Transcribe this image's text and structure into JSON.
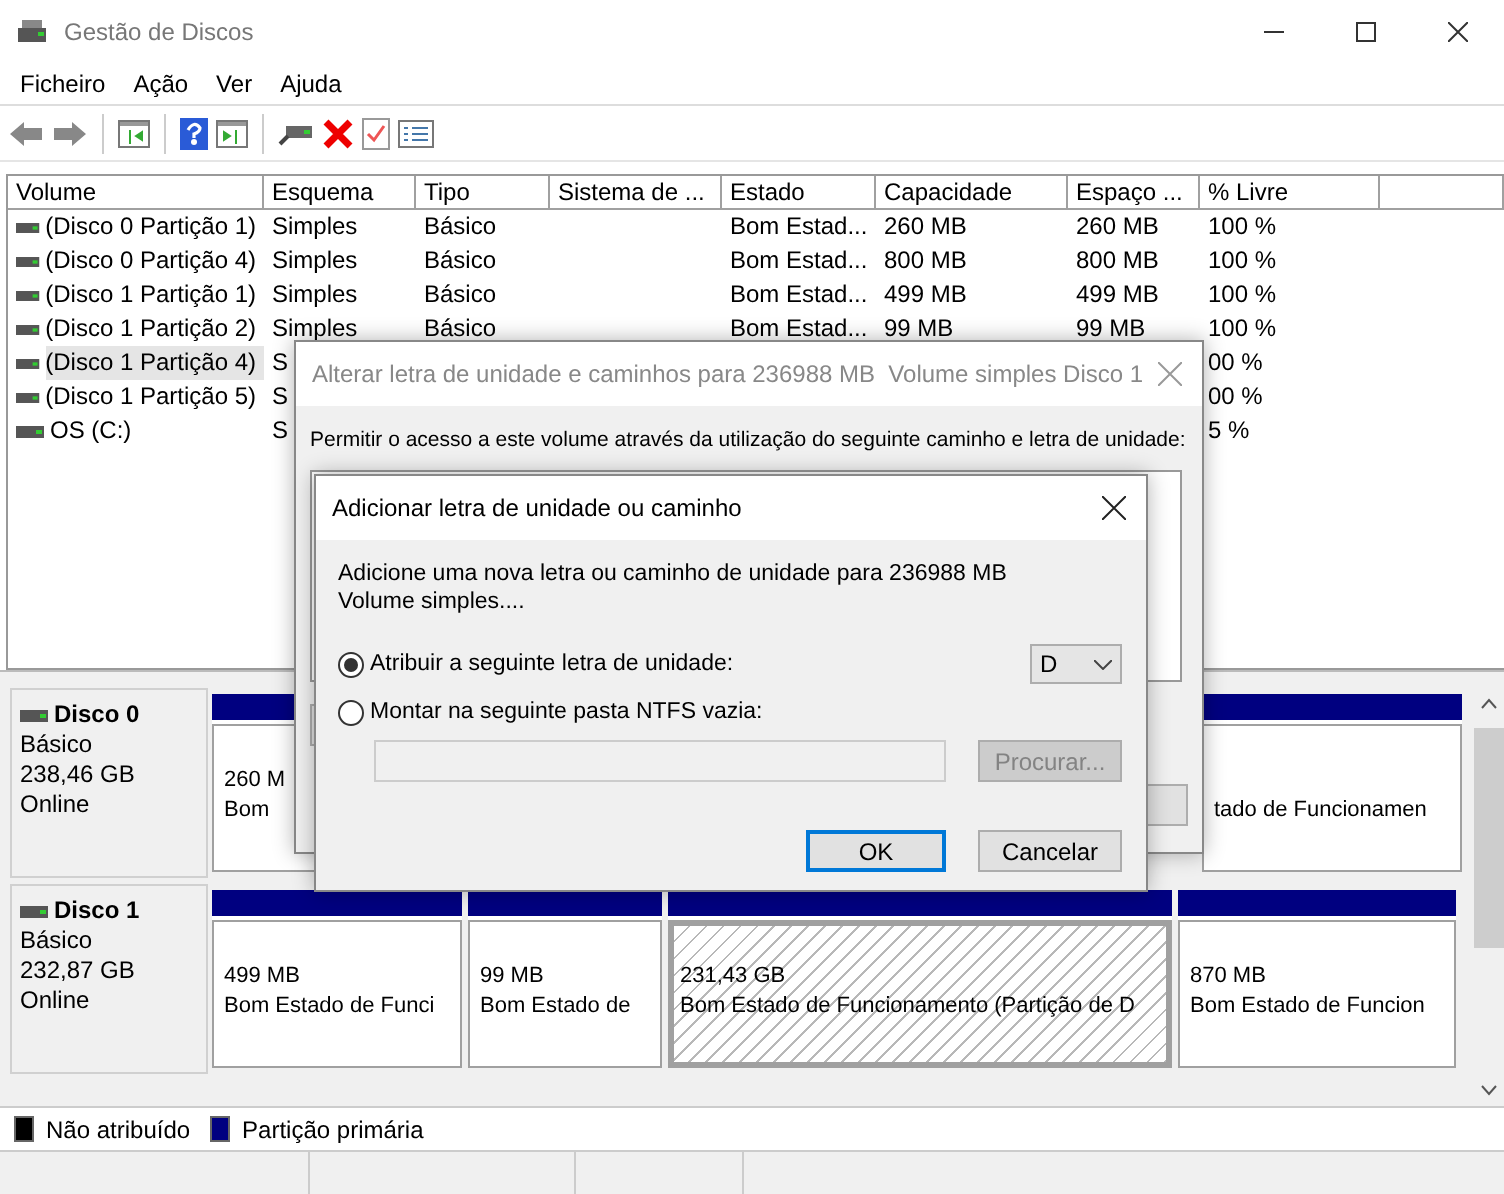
{
  "window": {
    "title": "Gestão de Discos"
  },
  "menu": [
    "Ficheiro",
    "Ação",
    "Ver",
    "Ajuda"
  ],
  "table": {
    "columns": [
      "Volume",
      "Esquema",
      "Tipo",
      "Sistema de ...",
      "Estado",
      "Capacidade",
      "Espaço ...",
      "% Livre"
    ],
    "rows": [
      {
        "selected": false,
        "volume": "(Disco 0 Partição 1)",
        "esquema": "Simples",
        "tipo": "Básico",
        "estado": "Bom Estad...",
        "capacidade": "260 MB",
        "espaco": "260 MB",
        "livre": "100 %"
      },
      {
        "selected": false,
        "volume": "(Disco 0 Partição 4)",
        "esquema": "Simples",
        "tipo": "Básico",
        "estado": "Bom Estad...",
        "capacidade": "800 MB",
        "espaco": "800 MB",
        "livre": "100 %"
      },
      {
        "selected": false,
        "volume": "(Disco 1 Partição 1)",
        "esquema": "Simples",
        "tipo": "Básico",
        "estado": "Bom Estad...",
        "capacidade": "499 MB",
        "espaco": "499 MB",
        "livre": "100 %"
      },
      {
        "selected": false,
        "volume": "(Disco 1 Partição 2)",
        "esquema": "Simples",
        "tipo": "Básico",
        "estado": "Bom Estad...",
        "capacidade": "99 MB",
        "espaco": "99 MB",
        "livre": "100 %"
      },
      {
        "selected": true,
        "volume": "(Disco 1 Partição 4)",
        "esquema": "S",
        "livre": "00 %"
      },
      {
        "selected": false,
        "volume": "(Disco 1 Partição 5)",
        "esquema": "S",
        "livre": "00 %"
      },
      {
        "selected": false,
        "volume": "OS (C:)",
        "esquema": "S",
        "livre": "5 %"
      }
    ]
  },
  "disks": [
    {
      "name": "Disco 0",
      "type": "Básico",
      "size": "238,46 GB",
      "status": "Online",
      "partitions": [
        {
          "size": "260 M",
          "status": "Bom",
          "selected": false
        },
        {
          "status": "tado de Funcionamen",
          "selected": false
        }
      ]
    },
    {
      "name": "Disco 1",
      "type": "Básico",
      "size": "232,87 GB",
      "status": "Online",
      "partitions": [
        {
          "size": "499 MB",
          "status": "Bom Estado de Funci",
          "selected": false
        },
        {
          "size": "99 MB",
          "status": "Bom Estado de",
          "selected": false
        },
        {
          "size": "231,43 GB",
          "status": "Bom Estado de Funcionamento (Partição de D",
          "selected": true
        },
        {
          "size": "870 MB",
          "status": "Bom Estado de Funcion",
          "selected": false
        }
      ]
    }
  ],
  "legend": [
    {
      "label": "Não atribuído",
      "color": "#000000"
    },
    {
      "label": "Partição primária",
      "color": "#000080"
    }
  ],
  "paths_dialog": {
    "title": "Alterar letra de unidade e caminhos para 236988 MB  Volume simples Disco 1",
    "prompt": "Permitir o acesso a este volume através da utilização do seguinte caminho e letra de unidade:"
  },
  "add_dialog": {
    "title": "Adicionar letra de unidade ou caminho",
    "description": "Adicione uma nova letra ou caminho de unidade para 236988 MB  Volume simples....",
    "options": [
      {
        "label": "Atribuir a seguinte letra de unidade:",
        "selected": true
      },
      {
        "label": "Montar na seguinte pasta NTFS vazia:",
        "selected": false
      }
    ],
    "drive_letter": "D",
    "folder_field": {
      "disabled": true
    },
    "browse_button": {
      "label": "Procurar...",
      "disabled": true
    },
    "buttons": [
      {
        "label": "OK",
        "focused": true
      },
      {
        "label": "Cancelar",
        "focused": false
      }
    ]
  }
}
